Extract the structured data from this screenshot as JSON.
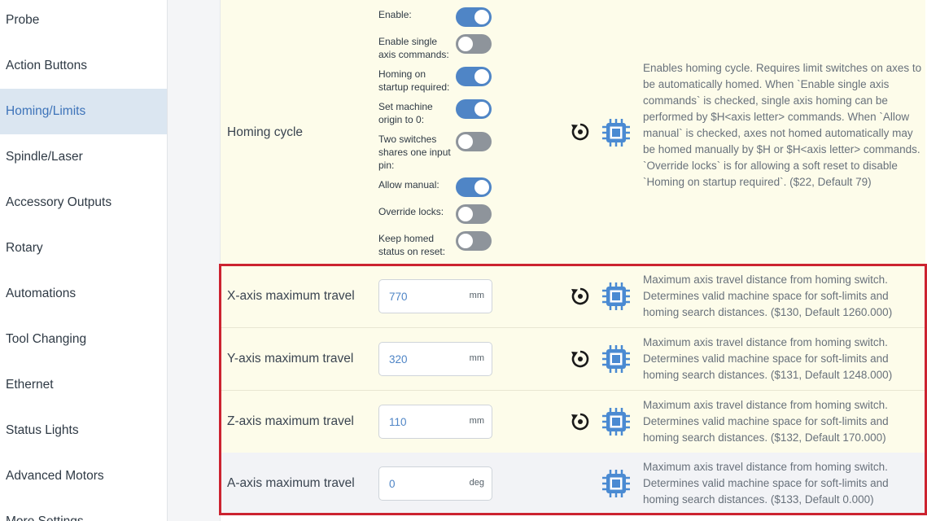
{
  "sidebar": {
    "items": [
      {
        "label": "Probe"
      },
      {
        "label": "Action Buttons"
      },
      {
        "label": "Homing/Limits"
      },
      {
        "label": "Spindle/Laser"
      },
      {
        "label": "Accessory Outputs"
      },
      {
        "label": "Rotary"
      },
      {
        "label": "Automations"
      },
      {
        "label": "Tool Changing"
      },
      {
        "label": "Ethernet"
      },
      {
        "label": "Status Lights"
      },
      {
        "label": "Advanced Motors"
      },
      {
        "label": "More Settings"
      }
    ]
  },
  "homing_cycle": {
    "label": "Homing cycle",
    "toggles": [
      {
        "label": "Enable:",
        "on": true
      },
      {
        "label": "Enable single axis commands:",
        "on": false
      },
      {
        "label": "Homing on startup required:",
        "on": true
      },
      {
        "label": "Set machine origin to 0:",
        "on": true
      },
      {
        "label": "Two switches shares one input pin:",
        "on": false
      },
      {
        "label": "Allow manual:",
        "on": true
      },
      {
        "label": "Override locks:",
        "on": false
      },
      {
        "label": "Keep homed status on reset:",
        "on": false
      }
    ],
    "description": "Enables homing cycle. Requires limit switches on axes to be automatically homed. When `Enable single axis commands` is checked, single axis homing can be performed by $H<axis letter> commands. When `Allow manual` is checked, axes not homed automatically may be homed manually by $H or $H<axis letter> commands. `Override locks` is for allowing a soft reset to disable `Homing on startup required`. ($22, Default 79)"
  },
  "axes": [
    {
      "label": "X-axis maximum travel",
      "value": "770",
      "unit": "mm",
      "description": "Maximum axis travel distance from homing switch. Determines valid machine space for soft-limits and homing search distances. ($130, Default 1260.000)"
    },
    {
      "label": "Y-axis maximum travel",
      "value": "320",
      "unit": "mm",
      "description": "Maximum axis travel distance from homing switch. Determines valid machine space for soft-limits and homing search distances. ($131, Default 1248.000)"
    },
    {
      "label": "Z-axis maximum travel",
      "value": "110",
      "unit": "mm",
      "description": "Maximum axis travel distance from homing switch. Determines valid machine space for soft-limits and homing search distances. ($132, Default 170.000)"
    },
    {
      "label": "A-axis maximum travel",
      "value": "0",
      "unit": "deg",
      "description": "Maximum axis travel distance from homing switch. Determines valid machine space for soft-limits and homing search distances. ($133, Default 0.000)"
    }
  ],
  "colors": {
    "accent": "#4f85c6",
    "active_nav_bg": "#dbe6f1",
    "row_bg": "#fdfcea",
    "highlight_border": "#cc2330"
  },
  "icons": {
    "reset": "reset-icon",
    "chip": "chip-icon"
  }
}
